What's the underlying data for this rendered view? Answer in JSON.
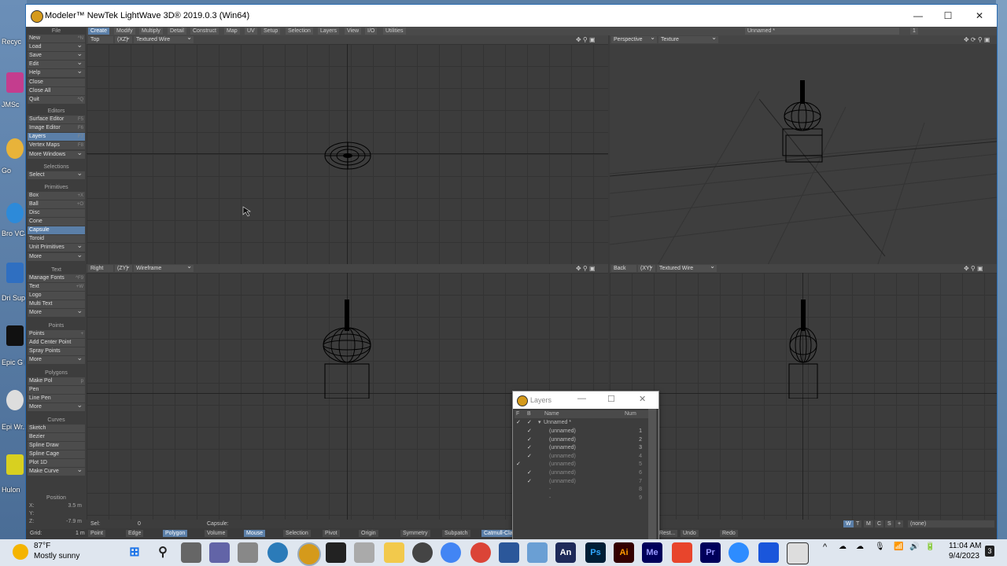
{
  "desktop": {
    "icons": [
      "Recyc",
      "JMSc",
      "Go",
      "Bro VCarv",
      "Dri Suppo",
      "Epic G Laun",
      "Epi Wr... V",
      "Hulon"
    ]
  },
  "window": {
    "title": "Modeler™ NewTek LightWave 3D® 2019.0.3 (Win64)",
    "min": "—",
    "max": "☐",
    "close": "✕"
  },
  "menubar": {
    "items": [
      "Create",
      "Modify",
      "Multiply",
      "Detail",
      "Construct",
      "Map",
      "UV",
      "Setup",
      "Selection",
      "Layers",
      "View",
      "I/O",
      "Utilities"
    ],
    "object_name": "Unnamed *",
    "layer_num": "1"
  },
  "toolbar": {
    "file_header": "File",
    "file": [
      {
        "label": "New",
        "key": "^N"
      },
      {
        "label": "Load",
        "key": ""
      },
      {
        "label": "Save",
        "key": ""
      },
      {
        "label": "Edit",
        "key": ""
      },
      {
        "label": "Help",
        "key": ""
      },
      {
        "label": "Close",
        "key": ""
      },
      {
        "label": "Close All",
        "key": ""
      },
      {
        "label": "Quit",
        "key": "^Q"
      }
    ],
    "editors_header": "Editors",
    "editors": [
      {
        "label": "Surface Editor",
        "key": "F5"
      },
      {
        "label": "Image Editor",
        "key": "F6"
      },
      {
        "label": "Layers",
        "key": "F7"
      },
      {
        "label": "Vertex Maps",
        "key": "F8"
      },
      {
        "label": "More Windows",
        "key": ""
      }
    ],
    "selections_header": "Selections",
    "selections": [
      {
        "label": "Select",
        "key": ""
      }
    ],
    "primitives_header": "Primitives",
    "primitives": [
      {
        "label": "Box",
        "key": "+X"
      },
      {
        "label": "Ball",
        "key": "+O"
      },
      {
        "label": "Disc",
        "key": ""
      },
      {
        "label": "Cone",
        "key": ""
      },
      {
        "label": "Capsule",
        "key": ""
      },
      {
        "label": "Toroid",
        "key": ""
      },
      {
        "label": "Unit Primitives",
        "key": ""
      },
      {
        "label": "More",
        "key": ""
      }
    ],
    "text_header": "Text",
    "text": [
      {
        "label": "Manage Fonts",
        "key": "^F9"
      },
      {
        "label": "Text",
        "key": "+W"
      },
      {
        "label": "Logo",
        "key": ""
      },
      {
        "label": "Multi Text",
        "key": ""
      },
      {
        "label": "More",
        "key": ""
      }
    ],
    "points_header": "Points",
    "points": [
      {
        "label": "Points",
        "key": "+"
      },
      {
        "label": "Add Center Point",
        "key": ""
      },
      {
        "label": "Spray Points",
        "key": ""
      },
      {
        "label": "More",
        "key": ""
      }
    ],
    "polygons_header": "Polygons",
    "polygons": [
      {
        "label": "Make Pol",
        "key": "p"
      },
      {
        "label": "Pen",
        "key": ""
      },
      {
        "label": "Line Pen",
        "key": ""
      },
      {
        "label": "More",
        "key": ""
      }
    ],
    "curves_header": "Curves",
    "curves": [
      {
        "label": "Sketch",
        "key": ""
      },
      {
        "label": "Bezier",
        "key": ""
      },
      {
        "label": "Spline Draw",
        "key": ""
      },
      {
        "label": "Spline Cage",
        "key": ""
      },
      {
        "label": "Plot 1D",
        "key": ""
      },
      {
        "label": "Make Curve",
        "key": ""
      }
    ],
    "position_label": "Position",
    "x_label": "X:",
    "x_val": "3.5 m",
    "y_label": "Y:",
    "y_val": "",
    "z_label": "Z:",
    "z_val": "-7.9 m",
    "grid_label": "Grid:",
    "grid_val": "1 m"
  },
  "viewports": {
    "top": {
      "view": "Top",
      "axis": "(XZ)",
      "mode": "Textured Wire"
    },
    "persp": {
      "view": "Perspective",
      "mode": "Texture"
    },
    "right": {
      "view": "Right",
      "axis": "(ZY)",
      "mode": "Wireframe"
    },
    "back": {
      "view": "Back",
      "axis": "(XY)",
      "mode": "Textured Wire"
    }
  },
  "statusbar": {
    "sel_label": "Sel:",
    "sel_val": "0",
    "tool": "Capsule:",
    "modes": [
      "W",
      "T",
      "M",
      "C",
      "S",
      "+"
    ],
    "layer_sel": "(none)"
  },
  "bottombar": {
    "items": [
      "Point",
      "Edge",
      "Polygon",
      "Mouse",
      "Volume",
      "Selection",
      "Pivot",
      "Origin",
      "Symmetry",
      "Subpatch",
      "Catmull-Clark",
      "Rest...",
      "Undo",
      "Redo"
    ]
  },
  "layers_panel": {
    "title": "Layers",
    "col_f": "F",
    "col_b": "B",
    "col_name": "Name",
    "col_num": "Num",
    "root": "Unnamed *",
    "rows": [
      {
        "f": "",
        "b": "✓",
        "name": "(unnamed)",
        "num": "1",
        "dim": false
      },
      {
        "f": "",
        "b": "✓",
        "name": "(unnamed)",
        "num": "2",
        "dim": false
      },
      {
        "f": "",
        "b": "✓",
        "name": "(unnamed)",
        "num": "3",
        "dim": false
      },
      {
        "f": "",
        "b": "✓",
        "name": "(unnamed)",
        "num": "4",
        "dim": true
      },
      {
        "f": "✓",
        "b": "",
        "name": "(unnamed)",
        "num": "5",
        "dim": true
      },
      {
        "f": "",
        "b": "✓",
        "name": "(unnamed)",
        "num": "6",
        "dim": true
      },
      {
        "f": "",
        "b": "✓",
        "name": "(unnamed)",
        "num": "7",
        "dim": true
      },
      {
        "f": "",
        "b": "",
        "name": "-",
        "num": "8",
        "dim": true
      },
      {
        "f": "",
        "b": "",
        "name": "-",
        "num": "9",
        "dim": true
      }
    ]
  },
  "taskbar": {
    "weather_temp": "87°F",
    "weather_desc": "Mostly sunny",
    "time": "11:04 AM",
    "date": "9/4/2023",
    "notif_count": "3",
    "apps": [
      "An",
      "Ps",
      "Ai",
      "Me",
      "Pr"
    ]
  }
}
